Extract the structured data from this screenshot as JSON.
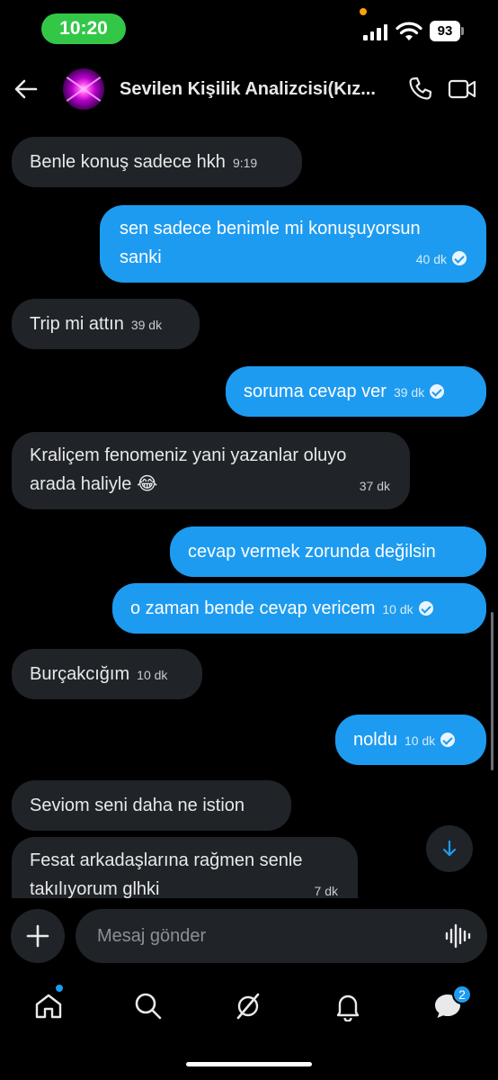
{
  "status_bar": {
    "time": "10:20",
    "battery": "93"
  },
  "header": {
    "title": "Sevilen Kişilik Analizcisi(Kız..."
  },
  "messages": [
    {
      "side": "in",
      "text": "Benle konuş sadece hkh",
      "time": "9:19"
    },
    {
      "side": "out",
      "text": "sen sadece benimle mi konuşuyorsun sanki",
      "time": "40 dk",
      "read": true
    },
    {
      "side": "in",
      "text": "Trip mi attın",
      "time": "39 dk"
    },
    {
      "side": "out",
      "text": "soruma cevap ver",
      "time": "39 dk",
      "read": true
    },
    {
      "side": "in",
      "text": "Kraliçem fenomeniz yani yazanlar oluyo arada haliyle 😂",
      "time": "37 dk"
    },
    {
      "side": "out",
      "text": "cevap vermek zorunda değilsin",
      "time": ""
    },
    {
      "side": "out",
      "text": "o zaman bende cevap vericem",
      "time": "10 dk",
      "read": true
    },
    {
      "side": "in",
      "text": "Burçakcığım",
      "time": "10 dk"
    },
    {
      "side": "out",
      "text": "noldu",
      "time": "10 dk",
      "read": true
    },
    {
      "side": "in",
      "text": "Seviom seni daha ne istion",
      "time": ""
    },
    {
      "side": "in",
      "text": "Fesat arkadaşlarına rağmen senle takılıyorum glhki",
      "time": "7 dk"
    }
  ],
  "composer": {
    "placeholder": "Mesaj gönder"
  },
  "bottom_nav": {
    "messages_badge": "2"
  },
  "colors": {
    "accent": "#1d9bf0",
    "incoming_bubble": "#202327",
    "background": "#000000"
  },
  "icons": [
    "back-arrow-icon",
    "phone-icon",
    "video-camera-icon",
    "chevron-down-arrow-icon",
    "plus-icon",
    "voice-wave-icon",
    "home-icon",
    "search-icon",
    "grok-icon",
    "bell-icon",
    "messages-icon"
  ]
}
